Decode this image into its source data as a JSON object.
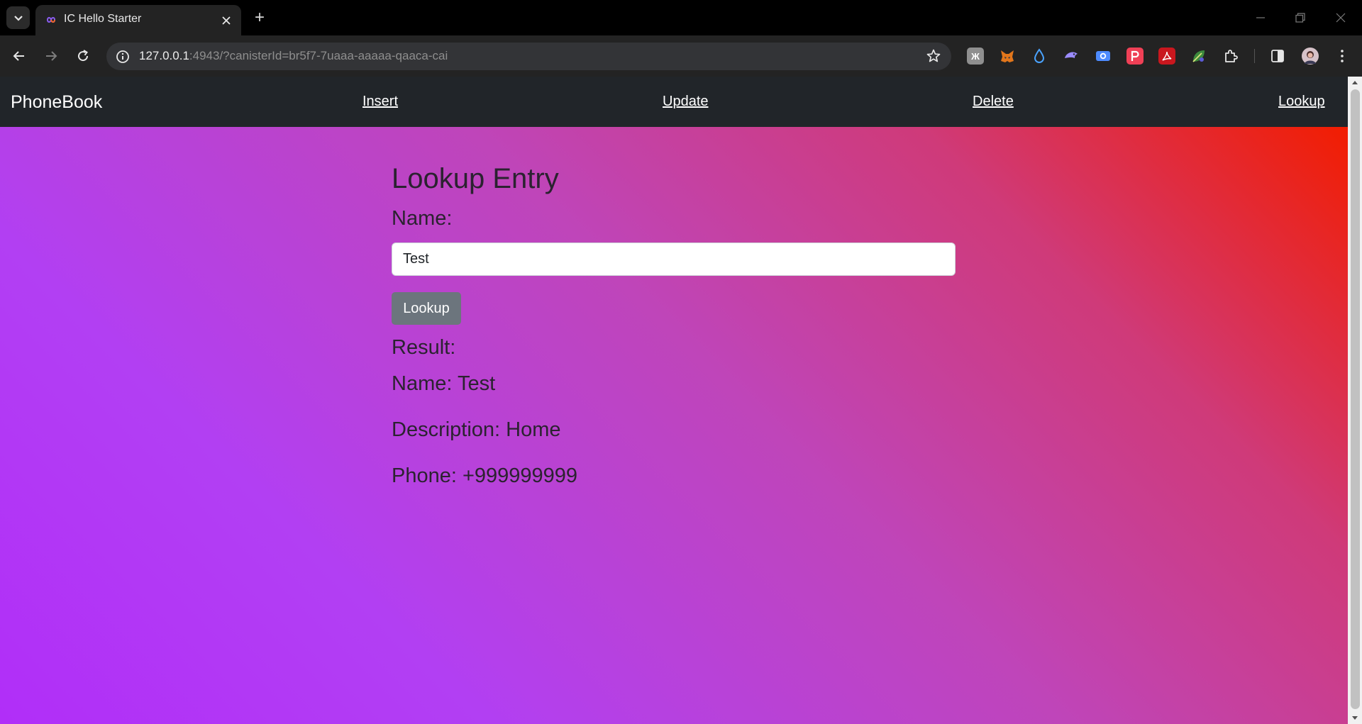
{
  "browser": {
    "tab_title": "IC Hello Starter",
    "new_tab_symbol": "+",
    "url_host": "127.0.0.1",
    "url_rest": ":4943/?canisterId=br5f7-7uaaa-aaaaa-qaaca-cai",
    "extensions": [
      "puzzle-square-extension",
      "metamask-fox-extension",
      "droplet-extension",
      "dolphin-extension",
      "camera-extension",
      "pocket-extension",
      "acrobat-extension",
      "leaf-extension"
    ]
  },
  "navbar": {
    "brand": "PhoneBook",
    "links": [
      "Insert",
      "Update",
      "Delete",
      "Lookup"
    ]
  },
  "form": {
    "title": "Lookup Entry",
    "name_label": "Name:",
    "name_value": "Test",
    "button_label": "Lookup"
  },
  "result": {
    "label": "Result:",
    "name": "Name: Test",
    "description": "Description: Home",
    "phone": "Phone: +999999999"
  },
  "colors": {
    "navbar_bg": "#212529",
    "button_bg": "#6c757d",
    "gradient_red": "#f21d00",
    "gradient_purple": "#b12ef8"
  }
}
